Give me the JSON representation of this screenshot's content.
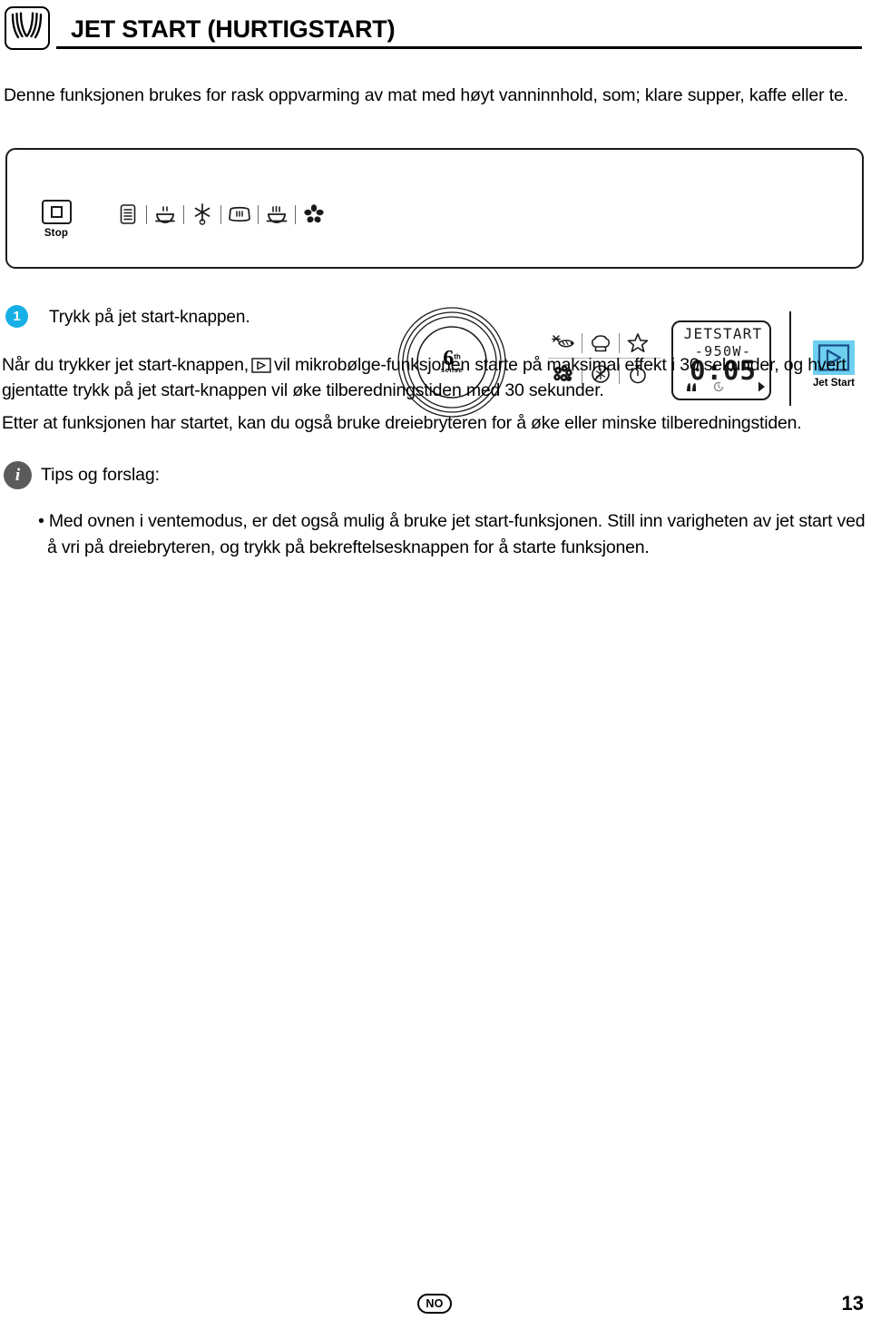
{
  "header": {
    "icon": "microwave-waves-icon",
    "title": "JET START (HURTIGSTART)"
  },
  "intro": {
    "text": "Denne funksjonen brukes for rask oppvarming av mat med høyt vanninnhold, som; klare supper, kaffe eller te."
  },
  "panel": {
    "stop": {
      "label": "Stop",
      "icon": "stop-square-icon"
    },
    "function_icons": [
      {
        "name": "menu-list-icon"
      },
      {
        "name": "steam-dish-icon"
      },
      {
        "name": "defrost-snowflake-icon"
      },
      {
        "name": "crisp-pan-icon"
      },
      {
        "name": "grill-rack-icon"
      },
      {
        "name": "fan-forced-air-icon"
      }
    ],
    "dial": {
      "name": "6th-sense-dial",
      "six": "6",
      "superscript": "th",
      "sense": "sense"
    },
    "right_icons_row1": [
      {
        "name": "bread-wheat-icon"
      },
      {
        "name": "chef-hat-icon"
      },
      {
        "name": "star-favourite-icon"
      }
    ],
    "right_icons_row2": [
      {
        "name": "popcorn-icon"
      },
      {
        "name": "no-defrost-icon"
      },
      {
        "name": "timer-clock-icon"
      }
    ],
    "display": {
      "line1": "JETSTART",
      "line2": "-950W-",
      "time": "0:05",
      "status_icons": [
        {
          "name": "fan-indicator-icon"
        },
        {
          "name": "clock-indicator-icon"
        },
        {
          "name": "play-indicator-icon"
        }
      ]
    },
    "jet_start": {
      "label": "Jet Start",
      "icon": "play-triangle-icon",
      "highlight_color": "#6ecff0"
    }
  },
  "step": {
    "number": "1",
    "badge_color": "#17b0e6",
    "text": "Trykk på jet start-knappen."
  },
  "body": {
    "para_a_before": "Når du trykker jet start-knappen,",
    "para_a_icon": "play-button-inline-icon",
    "para_a_after": "vil mikrobølge-funksjonen starte på maksimal effekt i 30 sekunder, og hvert gjentatte trykk på jet start-knappen vil øke tilberedningstiden med 30 sekunder.",
    "para_b": "Etter at funksjonen har startet, kan du også bruke dreiebryteren for å øke eller minske tilberedningstiden."
  },
  "tips": {
    "icon": "info-icon",
    "title": "Tips og forslag:",
    "bullet": "• Med ovnen i ventemodus, er det også mulig å bruke jet start-funksjonen. Still inn varigheten av jet start ved å vri på dreiebryteren, og trykk på bekreftelsesknappen for å starte funksjonen."
  },
  "footer": {
    "language_badge": "NO",
    "page_number": "13"
  }
}
